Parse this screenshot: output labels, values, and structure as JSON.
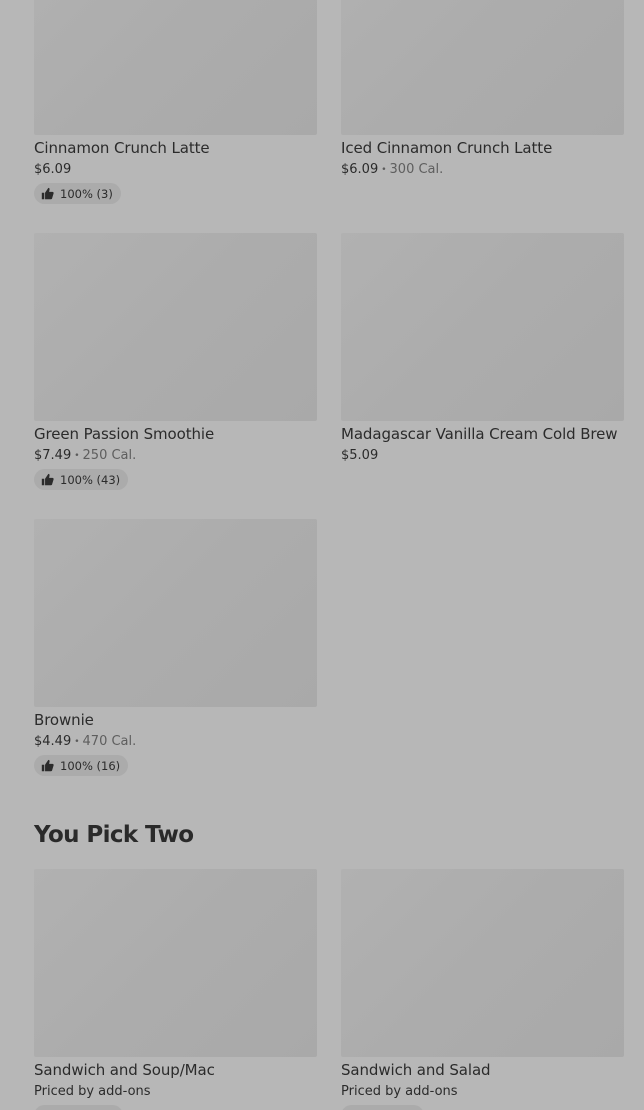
{
  "items": [
    {
      "name": "Cinnamon Crunch Latte",
      "price": "$6.09",
      "calories": "",
      "rating": "100% (3)"
    },
    {
      "name": "Iced Cinnamon Crunch Latte",
      "price": "$6.09",
      "calories": "300 Cal.",
      "rating": ""
    },
    {
      "name": "Green Passion Smoothie",
      "price": "$7.49",
      "calories": "250 Cal.",
      "rating": "100% (43)"
    },
    {
      "name": "Madagascar Vanilla Cream Cold Brew",
      "price": "$5.09",
      "calories": "",
      "rating": ""
    },
    {
      "name": "Brownie",
      "price": "$4.49",
      "calories": "470 Cal.",
      "rating": "100% (16)"
    }
  ],
  "section": {
    "title": "You Pick Two",
    "items": [
      {
        "name": "Sandwich and Soup/Mac",
        "price_note": "Priced by add-ons"
      },
      {
        "name": "Sandwich and Salad",
        "price_note": "Priced by add-ons"
      }
    ]
  },
  "separator": "•",
  "icons": {
    "rating": "thumbs-up-icon"
  }
}
